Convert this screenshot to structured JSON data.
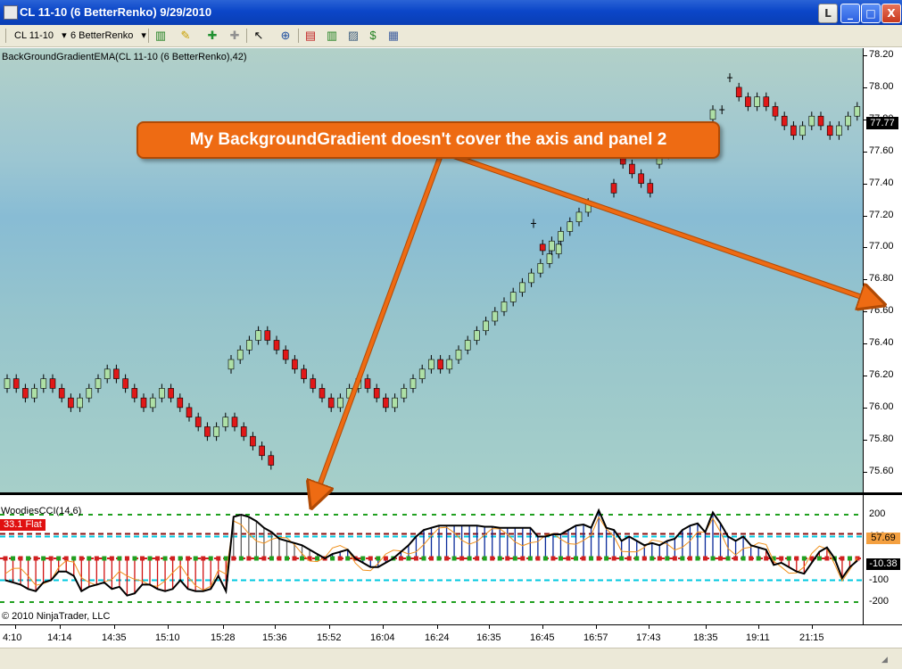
{
  "window": {
    "title": "CL 11-10 (6 BetterRenko)  9/29/2010",
    "buttons": {
      "layout": "L",
      "minimize": "_",
      "maximize": "□",
      "close": "X"
    }
  },
  "toolbar": {
    "instrument": "CL 11-10",
    "instrument_arrow": "▾",
    "bar_type": "6 BetterRenko",
    "bar_type_arrow": "▾",
    "icons": [
      "bar-style-icon",
      "draw-pen-icon",
      "indicator-icon",
      "strategy-icon",
      "cursor-icon",
      "zoom-icon",
      "data-box-icon",
      "chart-trader-icon",
      "overlay-icon",
      "dollar-icon",
      "properties-icon"
    ]
  },
  "price_panel": {
    "indicator_label": "BackGroundGradientEMA(CL 11-10 (6 BetterRenko),42)",
    "axis_ticks": [
      "78.20",
      "78.00",
      "77.80",
      "77.60",
      "77.40",
      "77.20",
      "77.00",
      "76.80",
      "76.60",
      "76.40",
      "76.20",
      "76.00",
      "75.80",
      "75.60"
    ],
    "last_price": "77.77",
    "colors": {
      "up_bar": "#aee0a6",
      "down_bar": "#e01818",
      "gradient_top": "#b2d0c8",
      "gradient_mid": "#88bcd4"
    }
  },
  "annotation": {
    "text": "My BackgroundGradient doesn't cover the axis and panel 2",
    "color": "#ee6b13"
  },
  "cci_panel": {
    "label": "WoodiesCCI(14,6)",
    "status": "33.1 Flat",
    "axis_ticks": [
      "200",
      "100",
      "-100",
      "-200"
    ],
    "value_tags": [
      "57.69",
      "-10.38"
    ],
    "watermark": "© 2010 NinjaTrader, LLC"
  },
  "time_axis": {
    "ticks": [
      "4:10",
      "14:14",
      "14:35",
      "15:10",
      "15:28",
      "15:36",
      "15:52",
      "16:04",
      "16:24",
      "16:35",
      "16:45",
      "16:57",
      "17:43",
      "18:35",
      "19:11",
      "21:15"
    ]
  },
  "chart_data": {
    "type": "candlestick",
    "title": "CL 11-10 (6 BetterRenko)",
    "indicator": "BackGroundGradientEMA(CL 11-10 (6 BetterRenko),42)",
    "ylim": [
      75.5,
      78.25
    ],
    "bars": [
      {
        "o": 76.12,
        "c": 76.18,
        "dir": "up"
      },
      {
        "o": 76.18,
        "c": 76.12,
        "dir": "down"
      },
      {
        "o": 76.12,
        "c": 76.06,
        "dir": "down"
      },
      {
        "o": 76.06,
        "c": 76.12,
        "dir": "up"
      },
      {
        "o": 76.12,
        "c": 76.18,
        "dir": "up"
      },
      {
        "o": 76.18,
        "c": 76.12,
        "dir": "down"
      },
      {
        "o": 76.12,
        "c": 76.06,
        "dir": "down"
      },
      {
        "o": 76.06,
        "c": 76.0,
        "dir": "down"
      },
      {
        "o": 76.0,
        "c": 76.06,
        "dir": "up"
      },
      {
        "o": 76.06,
        "c": 76.12,
        "dir": "up"
      },
      {
        "o": 76.12,
        "c": 76.18,
        "dir": "up"
      },
      {
        "o": 76.18,
        "c": 76.24,
        "dir": "up"
      },
      {
        "o": 76.24,
        "c": 76.18,
        "dir": "down"
      },
      {
        "o": 76.18,
        "c": 76.12,
        "dir": "down"
      },
      {
        "o": 76.12,
        "c": 76.06,
        "dir": "down"
      },
      {
        "o": 76.06,
        "c": 76.0,
        "dir": "down"
      },
      {
        "o": 76.0,
        "c": 76.06,
        "dir": "up"
      },
      {
        "o": 76.06,
        "c": 76.12,
        "dir": "up"
      },
      {
        "o": 76.12,
        "c": 76.06,
        "dir": "down"
      },
      {
        "o": 76.06,
        "c": 76.0,
        "dir": "down"
      },
      {
        "o": 76.0,
        "c": 75.94,
        "dir": "down"
      },
      {
        "o": 75.94,
        "c": 75.88,
        "dir": "down"
      },
      {
        "o": 75.88,
        "c": 75.82,
        "dir": "down"
      },
      {
        "o": 75.82,
        "c": 75.88,
        "dir": "up"
      },
      {
        "o": 75.88,
        "c": 75.94,
        "dir": "up"
      },
      {
        "o": 75.94,
        "c": 75.88,
        "dir": "down"
      },
      {
        "o": 75.88,
        "c": 75.82,
        "dir": "down"
      },
      {
        "o": 75.82,
        "c": 75.76,
        "dir": "down"
      },
      {
        "o": 75.76,
        "c": 75.7,
        "dir": "down"
      },
      {
        "o": 75.7,
        "c": 75.64,
        "dir": "down"
      },
      {
        "o": 76.24,
        "c": 76.3,
        "dir": "up"
      },
      {
        "o": 76.3,
        "c": 76.36,
        "dir": "up"
      },
      {
        "o": 76.36,
        "c": 76.42,
        "dir": "up"
      },
      {
        "o": 76.42,
        "c": 76.48,
        "dir": "up"
      },
      {
        "o": 76.48,
        "c": 76.42,
        "dir": "down"
      },
      {
        "o": 76.42,
        "c": 76.36,
        "dir": "down"
      },
      {
        "o": 76.36,
        "c": 76.3,
        "dir": "down"
      },
      {
        "o": 76.3,
        "c": 76.24,
        "dir": "down"
      },
      {
        "o": 76.24,
        "c": 76.18,
        "dir": "down"
      },
      {
        "o": 76.18,
        "c": 76.12,
        "dir": "down"
      },
      {
        "o": 76.12,
        "c": 76.06,
        "dir": "down"
      },
      {
        "o": 76.06,
        "c": 76.0,
        "dir": "down"
      },
      {
        "o": 76.0,
        "c": 76.06,
        "dir": "up"
      },
      {
        "o": 76.06,
        "c": 76.12,
        "dir": "up"
      },
      {
        "o": 76.12,
        "c": 76.18,
        "dir": "up"
      },
      {
        "o": 76.18,
        "c": 76.12,
        "dir": "down"
      },
      {
        "o": 76.12,
        "c": 76.06,
        "dir": "down"
      },
      {
        "o": 76.06,
        "c": 76.0,
        "dir": "down"
      },
      {
        "o": 76.0,
        "c": 76.06,
        "dir": "up"
      },
      {
        "o": 76.06,
        "c": 76.12,
        "dir": "up"
      },
      {
        "o": 76.12,
        "c": 76.18,
        "dir": "up"
      },
      {
        "o": 76.18,
        "c": 76.24,
        "dir": "up"
      },
      {
        "o": 76.24,
        "c": 76.3,
        "dir": "up"
      },
      {
        "o": 76.3,
        "c": 76.24,
        "dir": "down"
      },
      {
        "o": 76.24,
        "c": 76.3,
        "dir": "up"
      },
      {
        "o": 76.3,
        "c": 76.36,
        "dir": "up"
      },
      {
        "o": 76.36,
        "c": 76.42,
        "dir": "up"
      },
      {
        "o": 76.42,
        "c": 76.48,
        "dir": "up"
      },
      {
        "o": 76.48,
        "c": 76.54,
        "dir": "up"
      },
      {
        "o": 76.54,
        "c": 76.6,
        "dir": "up"
      },
      {
        "o": 76.6,
        "c": 76.66,
        "dir": "up"
      },
      {
        "o": 76.66,
        "c": 76.72,
        "dir": "up"
      },
      {
        "o": 76.72,
        "c": 76.78,
        "dir": "up"
      },
      {
        "o": 76.78,
        "c": 76.84,
        "dir": "up"
      },
      {
        "o": 76.84,
        "c": 76.9,
        "dir": "up"
      },
      {
        "o": 76.9,
        "c": 76.96,
        "dir": "up"
      },
      {
        "o": 76.96,
        "c": 77.02,
        "dir": "up"
      },
      {
        "o": 77.15,
        "c": 77.15,
        "dir": "doji"
      },
      {
        "o": 77.02,
        "c": 76.98,
        "dir": "down"
      },
      {
        "o": 76.98,
        "c": 77.04,
        "dir": "up"
      },
      {
        "o": 77.04,
        "c": 77.1,
        "dir": "up"
      },
      {
        "o": 77.1,
        "c": 77.16,
        "dir": "up"
      },
      {
        "o": 77.16,
        "c": 77.22,
        "dir": "up"
      },
      {
        "o": 77.22,
        "c": 77.28,
        "dir": "up"
      },
      {
        "o": 77.4,
        "c": 77.34,
        "dir": "down"
      },
      {
        "o": 77.58,
        "c": 77.52,
        "dir": "down"
      },
      {
        "o": 77.52,
        "c": 77.46,
        "dir": "down"
      },
      {
        "o": 77.46,
        "c": 77.4,
        "dir": "down"
      },
      {
        "o": 77.4,
        "c": 77.34,
        "dir": "down"
      },
      {
        "o": 77.52,
        "c": 77.58,
        "dir": "up"
      },
      {
        "o": 77.58,
        "c": 77.64,
        "dir": "up"
      },
      {
        "o": 77.8,
        "c": 77.86,
        "dir": "up"
      },
      {
        "o": 77.86,
        "c": 77.86,
        "dir": "doji"
      },
      {
        "o": 78.06,
        "c": 78.06,
        "dir": "doji"
      },
      {
        "o": 78.0,
        "c": 77.94,
        "dir": "down"
      },
      {
        "o": 77.94,
        "c": 77.88,
        "dir": "down"
      },
      {
        "o": 77.88,
        "c": 77.94,
        "dir": "up"
      },
      {
        "o": 77.94,
        "c": 77.88,
        "dir": "down"
      },
      {
        "o": 77.88,
        "c": 77.82,
        "dir": "down"
      },
      {
        "o": 77.82,
        "c": 77.76,
        "dir": "down"
      },
      {
        "o": 77.76,
        "c": 77.7,
        "dir": "down"
      },
      {
        "o": 77.7,
        "c": 77.76,
        "dir": "up"
      },
      {
        "o": 77.76,
        "c": 77.82,
        "dir": "up"
      },
      {
        "o": 77.82,
        "c": 77.76,
        "dir": "down"
      },
      {
        "o": 77.76,
        "c": 77.7,
        "dir": "down"
      },
      {
        "o": 77.7,
        "c": 77.76,
        "dir": "up"
      },
      {
        "o": 77.76,
        "c": 77.82,
        "dir": "up"
      },
      {
        "o": 77.82,
        "c": 77.88,
        "dir": "up"
      }
    ],
    "cci": [
      -100,
      -110,
      -120,
      -140,
      -150,
      -110,
      -100,
      -60,
      -60,
      -80,
      -150,
      -130,
      -120,
      -110,
      -140,
      -130,
      -170,
      -160,
      -120,
      -120,
      -140,
      -150,
      -140,
      -100,
      -140,
      -150,
      -150,
      -140,
      -80,
      -150,
      190,
      200,
      190,
      170,
      140,
      120,
      90,
      80,
      70,
      60,
      40,
      20,
      0,
      20,
      30,
      40,
      0,
      -20,
      -40,
      -40,
      -20,
      0,
      30,
      60,
      100,
      130,
      140,
      150,
      150,
      150,
      150,
      150,
      150,
      145,
      145,
      140,
      140,
      140,
      140,
      140,
      100,
      100,
      110,
      110,
      130,
      150,
      155,
      140,
      220,
      140,
      130,
      80,
      100,
      80,
      60,
      70,
      60,
      80,
      90,
      130,
      150,
      160,
      120,
      210,
      160,
      100,
      80,
      100,
      60,
      50,
      40,
      -30,
      -20,
      -40,
      -60,
      -70,
      -20,
      30,
      50,
      0,
      -90,
      -40,
      -10
    ]
  }
}
